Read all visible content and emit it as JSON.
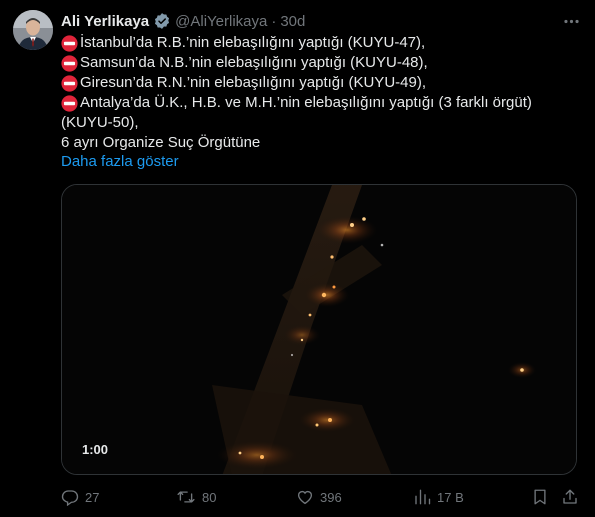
{
  "tweet": {
    "author_name": "Ali Yerlikaya",
    "handle": "@AliYerlikaya",
    "separator": "·",
    "time": "30d",
    "lines": [
      "İstanbul’da R.B.’nin elebaşılığını yaptığı (KUYU-47),",
      "Samsun’da N.B.’nin elebaşılığını yaptığı (KUYU-48),",
      "Giresun’da R.N.’nin elebaşılığını yaptığı (KUYU-49),",
      "Antalya’da Ü.K., H.B. ve M.H.’nin elebaşılığını yaptığı (3 farklı örgüt)",
      "(KUYU-50),",
      "6 ayrı Organize Suç Örgütüne"
    ],
    "show_more": "Daha fazla göster",
    "video_time": "1:00",
    "counts": {
      "replies": "27",
      "reposts": "80",
      "likes": "396",
      "views": "17 B"
    }
  },
  "colors": {
    "accent": "#1d9bf0",
    "muted": "#71767b",
    "text": "#e7e9ea",
    "background": "#000000",
    "no_entry": "#e0243a"
  },
  "icons": [
    "no-entry-icon",
    "verified-badge-icon",
    "more-icon",
    "reply-icon",
    "repost-icon",
    "like-icon",
    "views-icon",
    "bookmark-icon",
    "share-icon"
  ]
}
